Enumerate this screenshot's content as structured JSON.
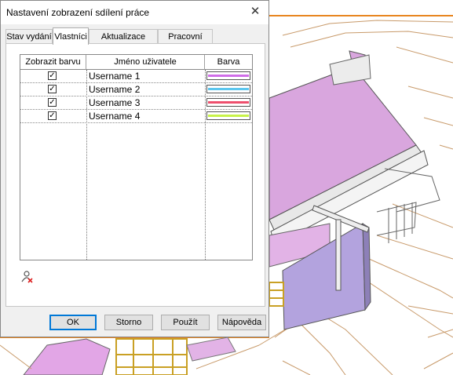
{
  "dialog": {
    "title": "Nastavení zobrazení sdílení práce",
    "close_glyph": "✕"
  },
  "tabs": [
    {
      "label": "Stav vydání",
      "active": false
    },
    {
      "label": "Vlastníci",
      "active": true
    },
    {
      "label": "Aktualizace modelu",
      "active": false
    },
    {
      "label": "Pracovní sady",
      "active": false
    }
  ],
  "table": {
    "columns": [
      "Zobrazit barvu",
      "Jméno uživatele",
      "Barva"
    ],
    "rows": [
      {
        "checked": true,
        "user": "Username 1",
        "color": "#d06ee8"
      },
      {
        "checked": true,
        "user": "Username 2",
        "color": "#5bc6ee"
      },
      {
        "checked": true,
        "user": "Username 3",
        "color": "#ee4f6d"
      },
      {
        "checked": true,
        "user": "Username 4",
        "color": "#c8f248"
      }
    ]
  },
  "icons": {
    "remove_user": "user-remove-icon",
    "checkbox_check": "✓"
  },
  "buttons": {
    "ok": "OK",
    "cancel": "Storno",
    "apply": "Použít",
    "help": "Nápověda"
  },
  "colors": {
    "highlight_frame": "#e8851f",
    "roof": "#d9a6de",
    "wall": "#b3a3de"
  }
}
